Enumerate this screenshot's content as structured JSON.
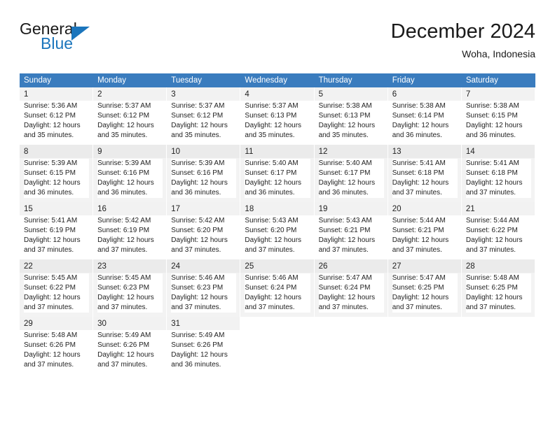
{
  "brand": {
    "name_part1": "General",
    "name_part2": "Blue",
    "logo_icon": "triangle-logo-icon",
    "accent_color": "#1b75bc"
  },
  "header": {
    "month_title": "December 2024",
    "location": "Woha, Indonesia"
  },
  "calendar": {
    "header_bg": "#3a7cbe",
    "weekday_headers": [
      "Sunday",
      "Monday",
      "Tuesday",
      "Wednesday",
      "Thursday",
      "Friday",
      "Saturday"
    ],
    "weeks": [
      [
        {
          "day": "1",
          "sunrise": "Sunrise: 5:36 AM",
          "sunset": "Sunset: 6:12 PM",
          "daylight_line1": "Daylight: 12 hours",
          "daylight_line2": "and 35 minutes."
        },
        {
          "day": "2",
          "sunrise": "Sunrise: 5:37 AM",
          "sunset": "Sunset: 6:12 PM",
          "daylight_line1": "Daylight: 12 hours",
          "daylight_line2": "and 35 minutes."
        },
        {
          "day": "3",
          "sunrise": "Sunrise: 5:37 AM",
          "sunset": "Sunset: 6:12 PM",
          "daylight_line1": "Daylight: 12 hours",
          "daylight_line2": "and 35 minutes."
        },
        {
          "day": "4",
          "sunrise": "Sunrise: 5:37 AM",
          "sunset": "Sunset: 6:13 PM",
          "daylight_line1": "Daylight: 12 hours",
          "daylight_line2": "and 35 minutes."
        },
        {
          "day": "5",
          "sunrise": "Sunrise: 5:38 AM",
          "sunset": "Sunset: 6:13 PM",
          "daylight_line1": "Daylight: 12 hours",
          "daylight_line2": "and 35 minutes."
        },
        {
          "day": "6",
          "sunrise": "Sunrise: 5:38 AM",
          "sunset": "Sunset: 6:14 PM",
          "daylight_line1": "Daylight: 12 hours",
          "daylight_line2": "and 36 minutes."
        },
        {
          "day": "7",
          "sunrise": "Sunrise: 5:38 AM",
          "sunset": "Sunset: 6:15 PM",
          "daylight_line1": "Daylight: 12 hours",
          "daylight_line2": "and 36 minutes."
        }
      ],
      [
        {
          "day": "8",
          "sunrise": "Sunrise: 5:39 AM",
          "sunset": "Sunset: 6:15 PM",
          "daylight_line1": "Daylight: 12 hours",
          "daylight_line2": "and 36 minutes."
        },
        {
          "day": "9",
          "sunrise": "Sunrise: 5:39 AM",
          "sunset": "Sunset: 6:16 PM",
          "daylight_line1": "Daylight: 12 hours",
          "daylight_line2": "and 36 minutes."
        },
        {
          "day": "10",
          "sunrise": "Sunrise: 5:39 AM",
          "sunset": "Sunset: 6:16 PM",
          "daylight_line1": "Daylight: 12 hours",
          "daylight_line2": "and 36 minutes."
        },
        {
          "day": "11",
          "sunrise": "Sunrise: 5:40 AM",
          "sunset": "Sunset: 6:17 PM",
          "daylight_line1": "Daylight: 12 hours",
          "daylight_line2": "and 36 minutes."
        },
        {
          "day": "12",
          "sunrise": "Sunrise: 5:40 AM",
          "sunset": "Sunset: 6:17 PM",
          "daylight_line1": "Daylight: 12 hours",
          "daylight_line2": "and 36 minutes."
        },
        {
          "day": "13",
          "sunrise": "Sunrise: 5:41 AM",
          "sunset": "Sunset: 6:18 PM",
          "daylight_line1": "Daylight: 12 hours",
          "daylight_line2": "and 37 minutes."
        },
        {
          "day": "14",
          "sunrise": "Sunrise: 5:41 AM",
          "sunset": "Sunset: 6:18 PM",
          "daylight_line1": "Daylight: 12 hours",
          "daylight_line2": "and 37 minutes."
        }
      ],
      [
        {
          "day": "15",
          "sunrise": "Sunrise: 5:41 AM",
          "sunset": "Sunset: 6:19 PM",
          "daylight_line1": "Daylight: 12 hours",
          "daylight_line2": "and 37 minutes."
        },
        {
          "day": "16",
          "sunrise": "Sunrise: 5:42 AM",
          "sunset": "Sunset: 6:19 PM",
          "daylight_line1": "Daylight: 12 hours",
          "daylight_line2": "and 37 minutes."
        },
        {
          "day": "17",
          "sunrise": "Sunrise: 5:42 AM",
          "sunset": "Sunset: 6:20 PM",
          "daylight_line1": "Daylight: 12 hours",
          "daylight_line2": "and 37 minutes."
        },
        {
          "day": "18",
          "sunrise": "Sunrise: 5:43 AM",
          "sunset": "Sunset: 6:20 PM",
          "daylight_line1": "Daylight: 12 hours",
          "daylight_line2": "and 37 minutes."
        },
        {
          "day": "19",
          "sunrise": "Sunrise: 5:43 AM",
          "sunset": "Sunset: 6:21 PM",
          "daylight_line1": "Daylight: 12 hours",
          "daylight_line2": "and 37 minutes."
        },
        {
          "day": "20",
          "sunrise": "Sunrise: 5:44 AM",
          "sunset": "Sunset: 6:21 PM",
          "daylight_line1": "Daylight: 12 hours",
          "daylight_line2": "and 37 minutes."
        },
        {
          "day": "21",
          "sunrise": "Sunrise: 5:44 AM",
          "sunset": "Sunset: 6:22 PM",
          "daylight_line1": "Daylight: 12 hours",
          "daylight_line2": "and 37 minutes."
        }
      ],
      [
        {
          "day": "22",
          "sunrise": "Sunrise: 5:45 AM",
          "sunset": "Sunset: 6:22 PM",
          "daylight_line1": "Daylight: 12 hours",
          "daylight_line2": "and 37 minutes."
        },
        {
          "day": "23",
          "sunrise": "Sunrise: 5:45 AM",
          "sunset": "Sunset: 6:23 PM",
          "daylight_line1": "Daylight: 12 hours",
          "daylight_line2": "and 37 minutes."
        },
        {
          "day": "24",
          "sunrise": "Sunrise: 5:46 AM",
          "sunset": "Sunset: 6:23 PM",
          "daylight_line1": "Daylight: 12 hours",
          "daylight_line2": "and 37 minutes."
        },
        {
          "day": "25",
          "sunrise": "Sunrise: 5:46 AM",
          "sunset": "Sunset: 6:24 PM",
          "daylight_line1": "Daylight: 12 hours",
          "daylight_line2": "and 37 minutes."
        },
        {
          "day": "26",
          "sunrise": "Sunrise: 5:47 AM",
          "sunset": "Sunset: 6:24 PM",
          "daylight_line1": "Daylight: 12 hours",
          "daylight_line2": "and 37 minutes."
        },
        {
          "day": "27",
          "sunrise": "Sunrise: 5:47 AM",
          "sunset": "Sunset: 6:25 PM",
          "daylight_line1": "Daylight: 12 hours",
          "daylight_line2": "and 37 minutes."
        },
        {
          "day": "28",
          "sunrise": "Sunrise: 5:48 AM",
          "sunset": "Sunset: 6:25 PM",
          "daylight_line1": "Daylight: 12 hours",
          "daylight_line2": "and 37 minutes."
        }
      ],
      [
        {
          "day": "29",
          "sunrise": "Sunrise: 5:48 AM",
          "sunset": "Sunset: 6:26 PM",
          "daylight_line1": "Daylight: 12 hours",
          "daylight_line2": "and 37 minutes."
        },
        {
          "day": "30",
          "sunrise": "Sunrise: 5:49 AM",
          "sunset": "Sunset: 6:26 PM",
          "daylight_line1": "Daylight: 12 hours",
          "daylight_line2": "and 37 minutes."
        },
        {
          "day": "31",
          "sunrise": "Sunrise: 5:49 AM",
          "sunset": "Sunset: 6:26 PM",
          "daylight_line1": "Daylight: 12 hours",
          "daylight_line2": "and 36 minutes."
        },
        {
          "day": "",
          "sunrise": "",
          "sunset": "",
          "daylight_line1": "",
          "daylight_line2": ""
        },
        {
          "day": "",
          "sunrise": "",
          "sunset": "",
          "daylight_line1": "",
          "daylight_line2": ""
        },
        {
          "day": "",
          "sunrise": "",
          "sunset": "",
          "daylight_line1": "",
          "daylight_line2": ""
        },
        {
          "day": "",
          "sunrise": "",
          "sunset": "",
          "daylight_line1": "",
          "daylight_line2": ""
        }
      ]
    ]
  }
}
